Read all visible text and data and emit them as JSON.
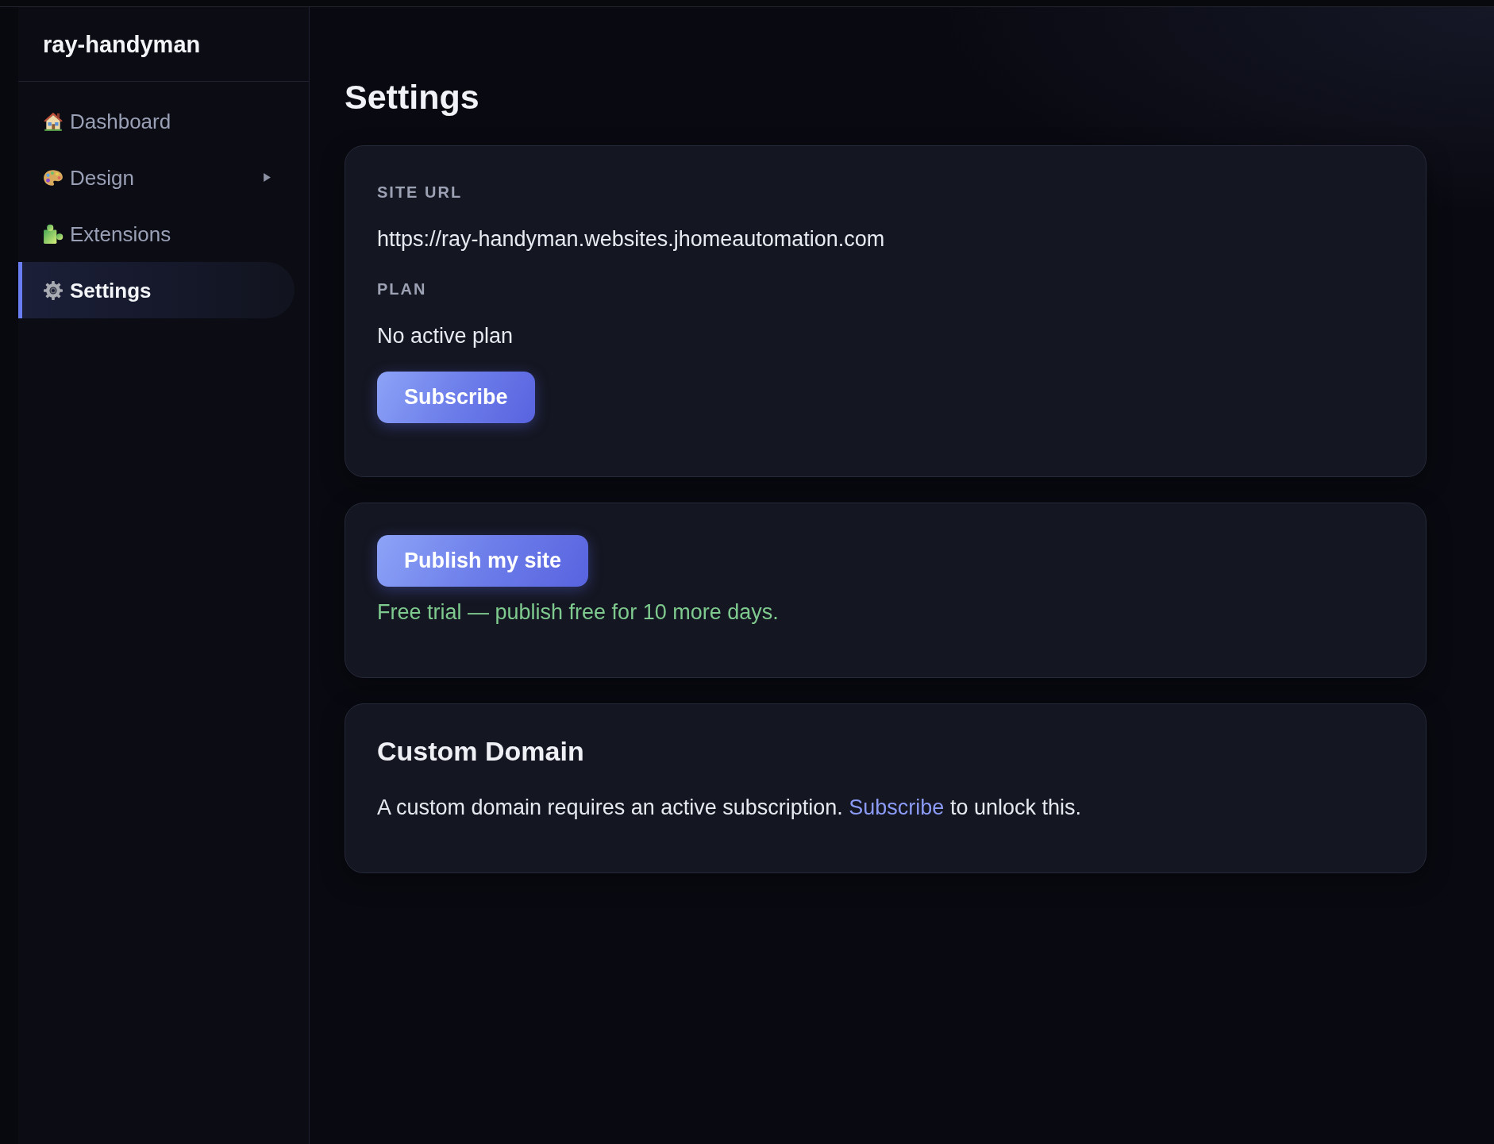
{
  "sidebar": {
    "brand": "ray-handyman",
    "items": [
      {
        "label": "Dashboard",
        "selected": false,
        "has_submenu": false
      },
      {
        "label": "Design",
        "selected": false,
        "has_submenu": true
      },
      {
        "label": "Extensions",
        "selected": false,
        "has_submenu": false
      },
      {
        "label": "Settings",
        "selected": true,
        "has_submenu": false
      }
    ]
  },
  "main": {
    "title": "Settings",
    "site_card": {
      "fields": [
        {
          "label": "SITE URL",
          "value": "https://ray-handyman.websites.jhomeautomation.com"
        },
        {
          "label": "PLAN",
          "value": "No active plan"
        }
      ],
      "button": "Subscribe"
    },
    "publish_card": {
      "button": "Publish my site",
      "note": "Free trial — publish free for 10 more days."
    },
    "domain_card": {
      "title": "Custom Domain",
      "text_before": "A custom domain requires an active subscription.",
      "link": "Subscribe",
      "text_after": "to unlock this."
    }
  }
}
